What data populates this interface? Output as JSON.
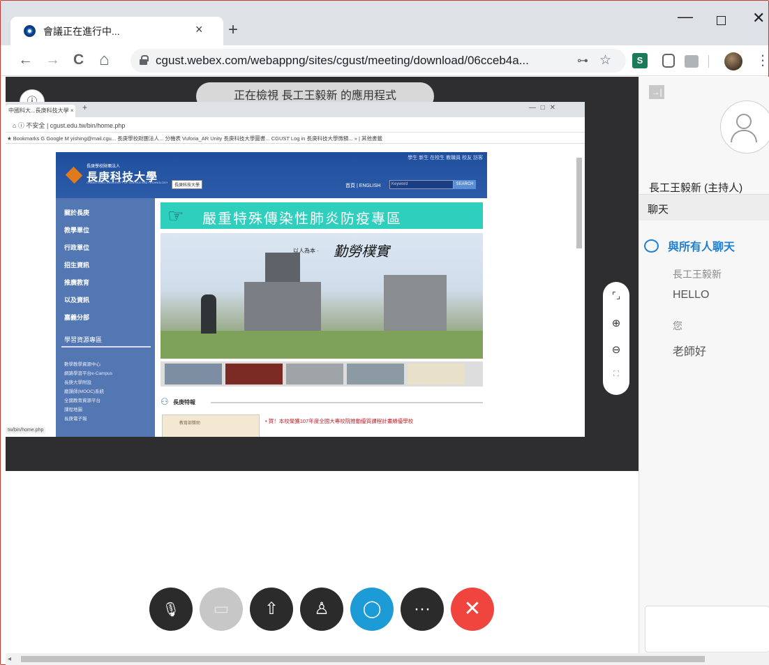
{
  "browser": {
    "tab_title": "會議正在進行中...",
    "tab_close": "×",
    "new_tab": "+",
    "window_controls": {
      "minimize": "—",
      "close": "✕"
    },
    "nav": {
      "back": "←",
      "forward": "→",
      "reload": "C",
      "home": "⌂"
    },
    "url": "cgust.webex.com/webappng/sites/cgust/meeting/download/06cceb4a...",
    "omnibox_icons": {
      "key": "⊶",
      "star": "☆"
    },
    "extension_s": "S",
    "menu": "⋮"
  },
  "stage": {
    "info_icon": "ⓘ",
    "viewing_banner": "正在檢視 長工王毅新 的應用程式"
  },
  "shared_screen": {
    "tab_label": "中國科大...長庚科技大學 ×",
    "new_tab": "+",
    "window_controls": "—   □   ✕",
    "address": "⌂  ⓘ 不安全 | cgust.edu.tw/bin/home.php",
    "bookmarks": "★ Bookmarks   G Google   M yishing@mail.cgu...   長庚學校財團法人...   分機表   Vuforia_AR   Unity   長庚科技大學圖書...   CGUST Log in   長庚科技大學微積...   »  | 其他書籤",
    "site": {
      "top_nav": "學生  新生  在校生  教職員  校友  訪客",
      "logo_sub": "長庚學校財團法人",
      "logo_main": "長庚科技大學",
      "logo_en": "CHANG GUNG UNIVERSITY OF SCIENCE AND TECHNOLOGY",
      "tooltip": "長庚科技大學",
      "lang": "首頁 | ENGLISH",
      "search_placeholder": "Keyword",
      "search_button": "SEARCH",
      "sidebar_items": [
        "關於長庚",
        "教學單位",
        "行政單位",
        "招生資訊",
        "推廣教育",
        "以及資訊",
        "嘉義分部"
      ],
      "sidebar_heading": "學習資源專區",
      "sidebar_links": [
        "數學教學資源中心",
        "網路學習平台e-Campus",
        "長庚大學附設",
        "磨課師(MOOC)系統",
        "全國教育資源平台",
        "課程地圖",
        "長庚電子報"
      ],
      "banner_icon": "☞",
      "banner": "嚴重特殊傳染性肺炎防疫專區",
      "slogan_small": "以人為本 ·",
      "slogan_big": "勤勞樸實",
      "news_icon": "⚇",
      "news_title": "長庚特報",
      "news_item": "• 賀！本校榮獲107年度全國大專校院推動優質課程計畫績優學校",
      "news_thumb": "教育部獎助",
      "status_url": "tw/bin/home.php"
    }
  },
  "zoom_panel": {
    "fit": "⌜⌟",
    "zoom_in": "⊕",
    "zoom_out": "⊖",
    "fullscreen": "⛶"
  },
  "controls": {
    "mute": "🎙",
    "video": "▭",
    "share": "⇧",
    "participants": "♙",
    "chat": "◯",
    "more": "···",
    "end": "✕"
  },
  "panel": {
    "collapse_icon": "→|",
    "host_label": "長工王毅新 (主持人)",
    "chat_header": "聊天",
    "chat_scope": "與所有人聊天",
    "messages": [
      {
        "sender": "長工王毅新",
        "text": "HELLO"
      },
      {
        "sender": "您",
        "text": "老師好"
      }
    ]
  },
  "colors": {
    "accent_blue": "#1d9bd7",
    "end_red": "#f0453f",
    "chat_blue": "#1d7fd4",
    "stage_bg": "#2e2e30",
    "banner_teal": "#2ecfbd",
    "site_blue": "#5377b2"
  }
}
